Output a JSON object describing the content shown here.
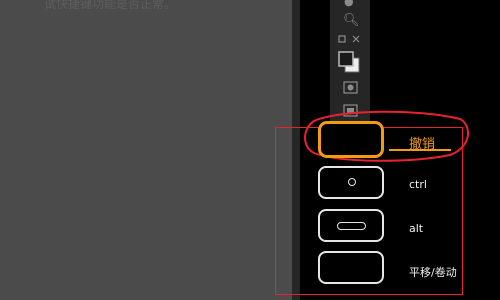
{
  "instruction": {
    "text": "试快捷键功能是否正常。"
  },
  "toolbar": {
    "icons": [
      "brush-icon",
      "zoom-icon",
      "transform-icon",
      "color-swatch-icon",
      "mask-icon",
      "screen-mode-icon"
    ]
  },
  "hotkeys": {
    "undo": {
      "label": "撤销",
      "highlight": "#f39c12"
    },
    "ctrl": {
      "label": "ctrl"
    },
    "alt": {
      "label": "alt"
    },
    "pan": {
      "label": "平移/卷动"
    }
  },
  "colors": {
    "annotation_red": "#e8222e",
    "highlight_orange": "#f39c12",
    "panel_gray": "#4b4b4b",
    "background": "#000000"
  }
}
